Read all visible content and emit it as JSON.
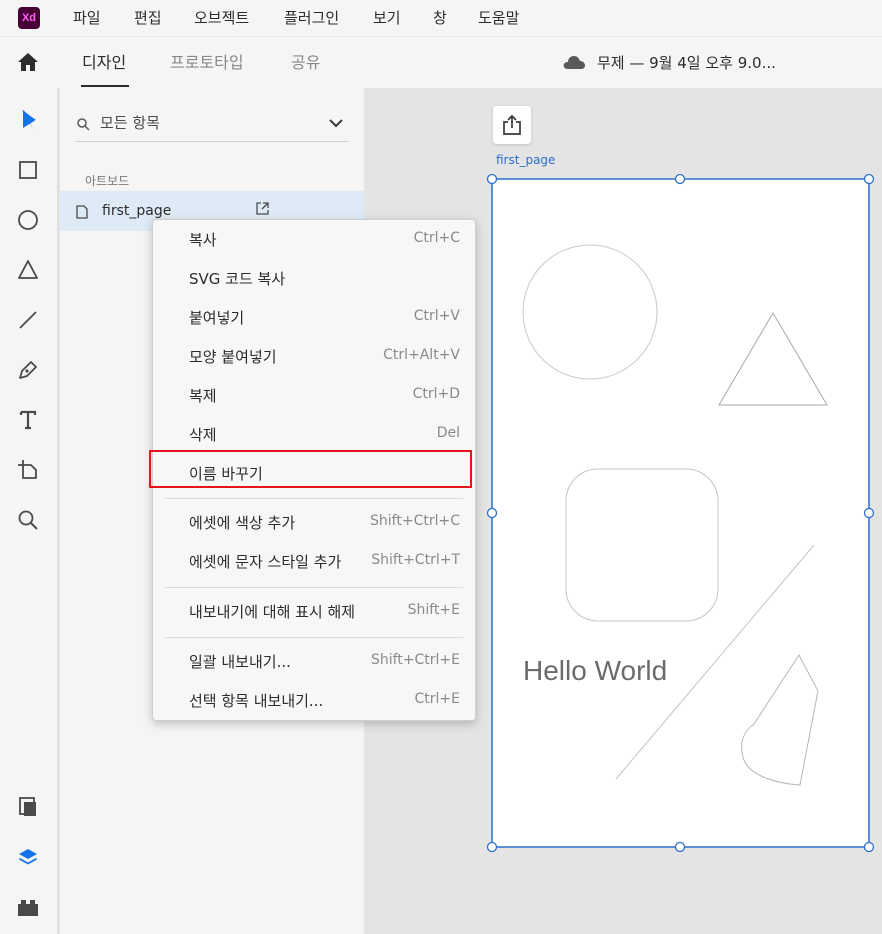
{
  "app": {
    "logo_text": "Xd"
  },
  "menubar": {
    "items": [
      "파일",
      "편집",
      "오브젝트",
      "플러그인",
      "보기",
      "창",
      "도움말"
    ]
  },
  "tabbar": {
    "tabs": [
      "디자인",
      "프로토타입",
      "공유"
    ],
    "active_tab": "디자인",
    "document_title": "무제 — 9월 4일 오후 9.0..."
  },
  "layers": {
    "search_placeholder": "모든 항목",
    "section_label": "아트보드",
    "items": [
      {
        "name": "first_page"
      }
    ]
  },
  "canvas": {
    "artboard_label": "first_page",
    "text_layer": "Hello World"
  },
  "context_menu": {
    "items": [
      {
        "label": "복사",
        "shortcut": "Ctrl+C"
      },
      {
        "label": "SVG 코드 복사",
        "shortcut": ""
      },
      {
        "label": "붙여넣기",
        "shortcut": "Ctrl+V"
      },
      {
        "label": "모양 붙여넣기",
        "shortcut": "Ctrl+Alt+V"
      },
      {
        "label": "복제",
        "shortcut": "Ctrl+D"
      },
      {
        "label": "삭제",
        "shortcut": "Del"
      },
      {
        "label": "이름 바꾸기",
        "shortcut": ""
      },
      {
        "label": "에셋에 색상 추가",
        "shortcut": "Shift+Ctrl+C"
      },
      {
        "label": "에셋에 문자 스타일 추가",
        "shortcut": "Shift+Ctrl+T"
      },
      {
        "label": "내보내기에 대해 표시 해제",
        "shortcut": "Shift+E"
      },
      {
        "label": "일괄 내보내기...",
        "shortcut": "Shift+Ctrl+E"
      },
      {
        "label": "선택 항목 내보내기...",
        "shortcut": "Ctrl+E"
      }
    ],
    "highlighted_item": "이름 바꾸기"
  },
  "colors": {
    "accent": "#2b6fc9",
    "selection_row": "#deebf7",
    "highlight_border": "#e8141b",
    "xd_logo_bg": "#470137",
    "xd_logo_fg": "#ff61f6"
  }
}
